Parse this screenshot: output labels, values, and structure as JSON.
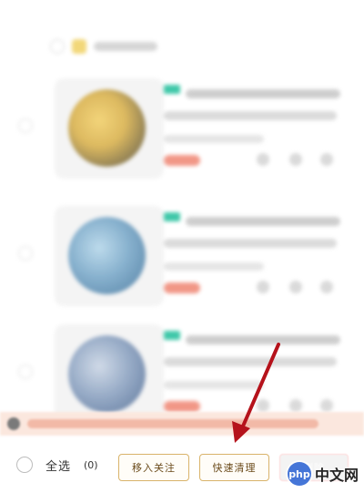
{
  "bottom_bar": {
    "select_all_label": "全选",
    "selected_count": "(0)",
    "move_to_favorites_label": "移入关注",
    "quick_clean_label": "快速清理",
    "delete_label": "删除"
  },
  "watermark": {
    "logo_text": "php",
    "site_text": "中文网"
  },
  "colors": {
    "button_border": "#d9b36a",
    "button_text": "#6b4b1b",
    "arrow": "#b5121b"
  }
}
